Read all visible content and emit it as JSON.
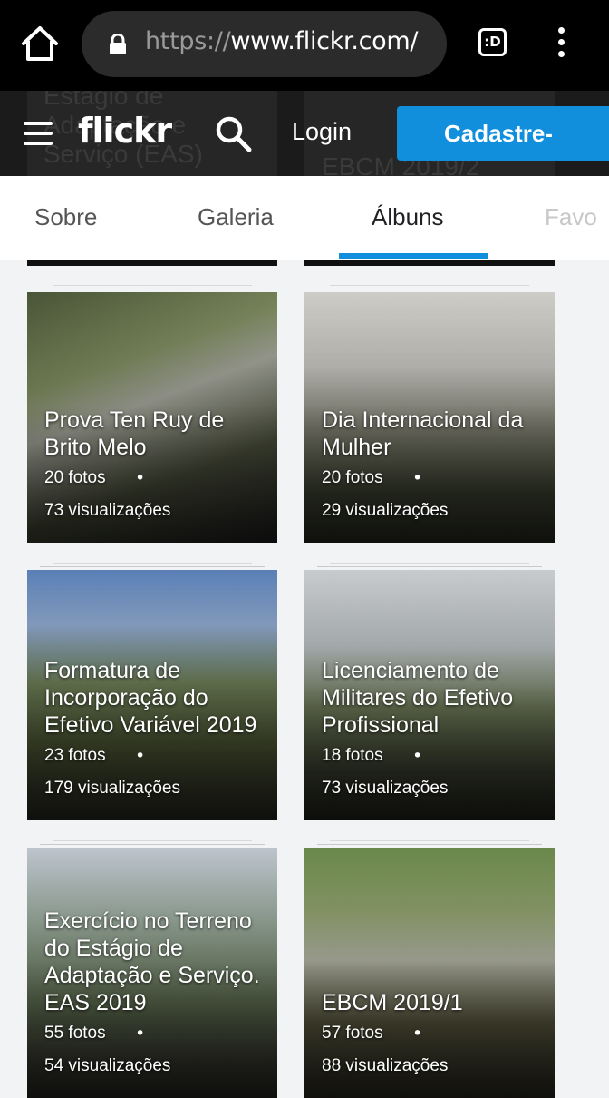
{
  "browser": {
    "url_scheme": "https://",
    "url_host": "www.flickr.com/",
    "tabs_icon_label": ":D",
    "icons": [
      "home-icon",
      "lock-icon",
      "tabs-icon",
      "more-vert-icon"
    ]
  },
  "header": {
    "logo": "flickr",
    "login_label": "Login",
    "signup_label": "Cadastre-",
    "background_text_left": "Estágio de Adaptação e Serviço (EAS)",
    "background_text_right": "EBCM 2019/2",
    "accent_color": "#128fdc"
  },
  "tabs": [
    {
      "label": "Sobre"
    },
    {
      "label": "Galeria"
    },
    {
      "label": "Álbuns"
    },
    {
      "label": "Favo"
    }
  ],
  "active_tab": "Álbuns",
  "albums": [
    {
      "title": "Prova Ten Ruy de Brito Melo",
      "photos": "20 fotos",
      "views": "73 visualizações"
    },
    {
      "title": "Dia Internacional da Mulher",
      "photos": "20 fotos",
      "views": "29 visualizações"
    },
    {
      "title": "Formatura de Incorporação do Efetivo Variável 2019",
      "photos": "23 fotos",
      "views": "179 visualizações"
    },
    {
      "title": "Licenciamento de Militares do Efetivo Profissional",
      "photos": "18 fotos",
      "views": "73 visualizações"
    },
    {
      "title": "Exercício no Terreno do Estágio de Adaptação e Serviço. EAS 2019",
      "photos": "55 fotos",
      "views": "54 visualizações"
    },
    {
      "title": "EBCM 2019/1",
      "photos": "57 fotos",
      "views": "88 visualizações"
    }
  ],
  "separator": "•"
}
